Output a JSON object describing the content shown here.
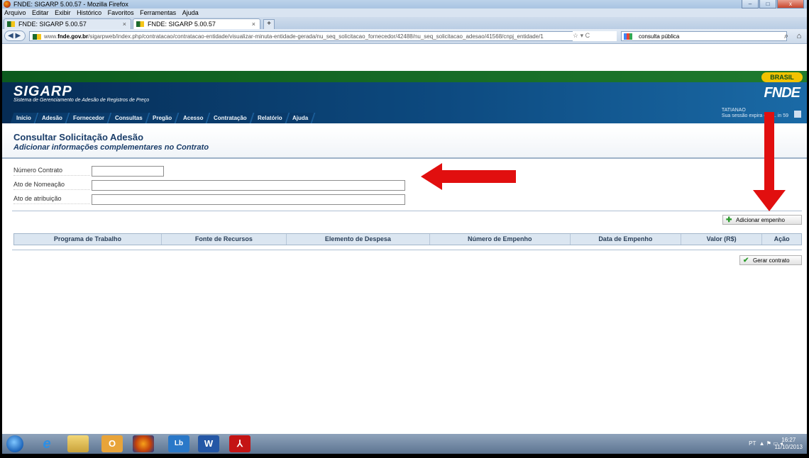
{
  "window": {
    "title": "FNDE: SIGARP 5.00.57 - Mozilla Firefox",
    "controls": [
      "–",
      "□",
      "x"
    ]
  },
  "menubar": [
    "Arquivo",
    "Editar",
    "Exibir",
    "Histórico",
    "Favoritos",
    "Ferramentas",
    "Ajuda"
  ],
  "tabs": [
    {
      "label": "FNDE: SIGARP 5.00.57",
      "active": false
    },
    {
      "label": "FNDE: SIGARP 5.00.57",
      "active": true
    }
  ],
  "tab_close": "×",
  "tab_new": "+",
  "navbar": {
    "back_fwd": "◀ ▶",
    "url_prefix": "www.",
    "url_domain": "fnde.gov.br",
    "url_rest": "/sigarpweb/index.php/contratacao/contratacao-entidade/visualizar-minuta-entidade-gerada/nu_seq_solicitacao_fornecedor/42488/nu_seq_solicitacao_adesao/41568/cnpj_entidade/1",
    "url_icons": "☆ ▾ C",
    "search_text": "consulta pública",
    "search_icon": "⌕",
    "home_icon": "⌂"
  },
  "site": {
    "brasil_badge": "BRASIL",
    "logo": "SIGARP",
    "logo_subtitle": "Sistema de Gerenciamento de Adesão de Registros de Preço",
    "org_logo": "FNDE",
    "user_name": "TATIANAO",
    "session_text": "Sua sessão expira em ... in 59",
    "menu": [
      "Início",
      "Adesão",
      "Fornecedor",
      "Consultas",
      "Pregão",
      "Acesso",
      "Contratação",
      "Relatório",
      "Ajuda"
    ]
  },
  "page": {
    "title": "Consultar Solicitação Adesão",
    "subtitle": "Adicionar informações complementares no Contrato"
  },
  "form": {
    "numero_contrato_label": "Número Contrato",
    "numero_contrato_value": "",
    "ato_nomeacao_label": "Ato de Nomeação",
    "ato_nomeacao_value": "",
    "ato_atribuicao_label": "Ato de atribuição",
    "ato_atribuicao_value": ""
  },
  "buttons": {
    "add_empenho": "Adicionar empenho",
    "gerar_contrato": "Gerar contrato"
  },
  "table": {
    "columns": [
      "Programa de Trabalho",
      "Fonte de Recursos",
      "Elemento de Despesa",
      "Número de Empenho",
      "Data de Empenho",
      "Valor (R$)",
      "Ação"
    ]
  },
  "taskbar": {
    "apps": [
      "ie",
      "explorer",
      "outlook",
      "firefox",
      "lync",
      "word",
      "acrobat"
    ],
    "tray_lang": "PT",
    "time": "16:27",
    "date": "11/10/2013"
  },
  "colors": {
    "header_dark": "#062c54",
    "accent_green": "#0c5a1e",
    "annotation_red": "#e10f0f",
    "title_text": "#1a3d69"
  }
}
